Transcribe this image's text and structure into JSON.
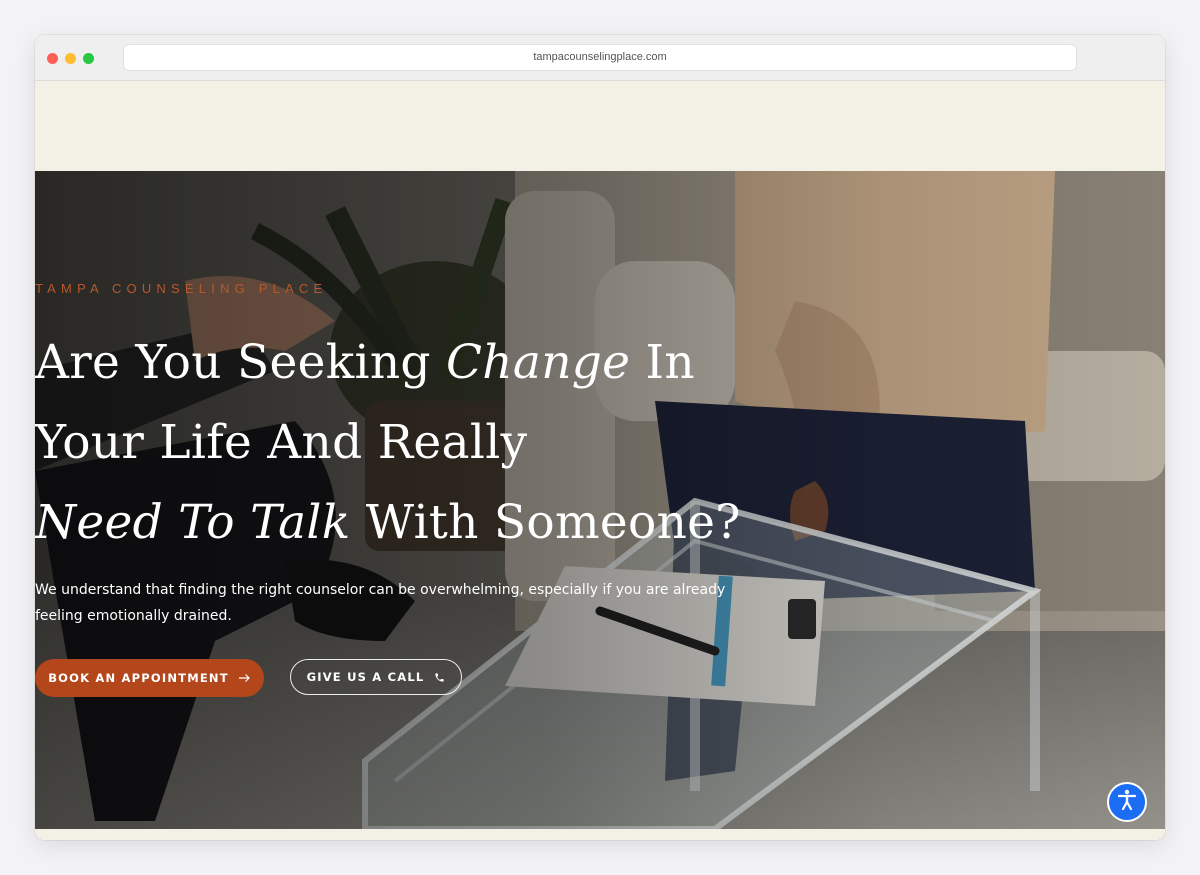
{
  "browser": {
    "url": "tampacounselingplace.com"
  },
  "hero": {
    "eyebrow": "TAMPA COUNSELING PLACE",
    "headline": {
      "line1_a": "Are You Seeking ",
      "line1_em": "Change",
      "line1_b": " In",
      "line2": "Your Life And Really",
      "line3_em": "Need To Talk",
      "line3_b": " With Someone?"
    },
    "subtext": "We understand that finding the right counselor can be overwhelming, especially if you are already feeling emotionally drained.",
    "book_button": "BOOK AN APPOINTMENT",
    "call_button": "GIVE US A CALL",
    "book_icon": "arrow-right-icon",
    "call_icon": "phone-icon"
  },
  "accessibility": {
    "icon": "accessibility-person-icon"
  },
  "colors": {
    "accent": "#b4461c",
    "eyebrow": "#b8582c",
    "band": "#f3f1e6",
    "a11y": "#1b6ef3"
  }
}
